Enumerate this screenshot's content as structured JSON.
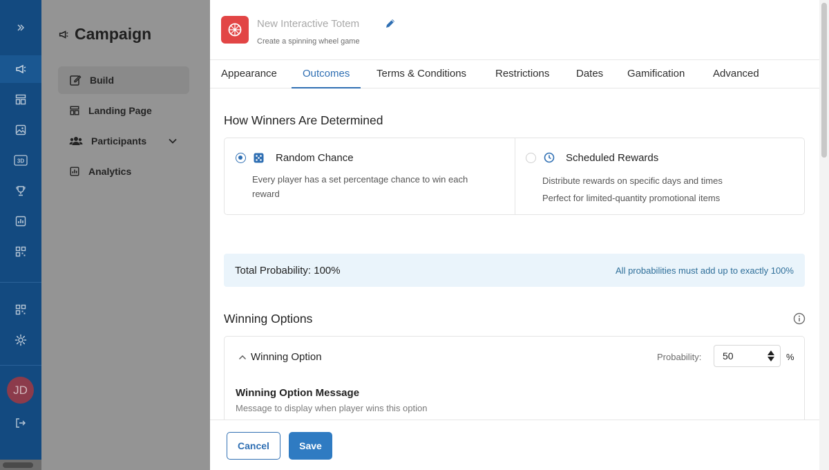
{
  "rail": {
    "expand_icon": "chevrons-right-icon",
    "items": [
      {
        "icon": "megaphone-icon",
        "active": true
      },
      {
        "icon": "layout-icon",
        "active": false
      },
      {
        "icon": "image-icon",
        "active": false
      },
      {
        "icon": "3d-icon",
        "label": "3D",
        "active": false
      },
      {
        "icon": "trophy-icon",
        "active": false
      },
      {
        "icon": "chart-icon",
        "active": false
      },
      {
        "icon": "qr-code-icon",
        "active": false
      }
    ],
    "bottom_items": [
      {
        "icon": "qr-code-icon"
      },
      {
        "icon": "gear-icon"
      }
    ],
    "avatar_initials": "JD",
    "logout_icon": "logout-icon"
  },
  "sidebar": {
    "title": "Campaign",
    "items": [
      {
        "label": "Build",
        "icon": "edit-icon",
        "active": true
      },
      {
        "label": "Landing Page",
        "icon": "layout-icon",
        "active": false
      },
      {
        "label": "Participants",
        "icon": "users-icon",
        "active": false,
        "expandable": true
      },
      {
        "label": "Analytics",
        "icon": "chart-icon",
        "active": false
      }
    ]
  },
  "header": {
    "title": "New Interactive Totem",
    "subtitle": "Create a spinning wheel game"
  },
  "tabs": [
    {
      "label": "Appearance",
      "active": false
    },
    {
      "label": "Outcomes",
      "active": true
    },
    {
      "label": "Terms & Conditions",
      "active": false
    },
    {
      "label": "Restrictions",
      "active": false
    },
    {
      "label": "Dates",
      "active": false
    },
    {
      "label": "Gamification",
      "active": false
    },
    {
      "label": "Advanced",
      "active": false
    }
  ],
  "winners": {
    "heading": "How Winners Are Determined",
    "options": [
      {
        "title": "Random Chance",
        "selected": true,
        "icon": "dice-icon",
        "desc_lines": [
          "Every player has a set percentage chance to win each",
          "reward"
        ]
      },
      {
        "title": "Scheduled Rewards",
        "selected": false,
        "icon": "clock-icon",
        "desc_lines": [
          "Distribute rewards on specific days and times",
          "Perfect for limited-quantity promotional items"
        ]
      }
    ]
  },
  "probability": {
    "total": "Total Probability: 100%",
    "note": "All probabilities must add up to exactly 100%"
  },
  "winning_options": {
    "heading": "Winning Options",
    "option": {
      "title": "Winning Option",
      "probability_label": "Probability:",
      "probability_value": "50",
      "unit": "%",
      "message_title": "Winning Option Message",
      "message_desc": "Message to display when player wins this option"
    }
  },
  "footer": {
    "cancel": "Cancel",
    "save": "Save"
  },
  "colors": {
    "accent": "#2f6fb3",
    "rail": "#134a80",
    "logo": "#e24545",
    "info_bar": "#eaf4fb"
  }
}
